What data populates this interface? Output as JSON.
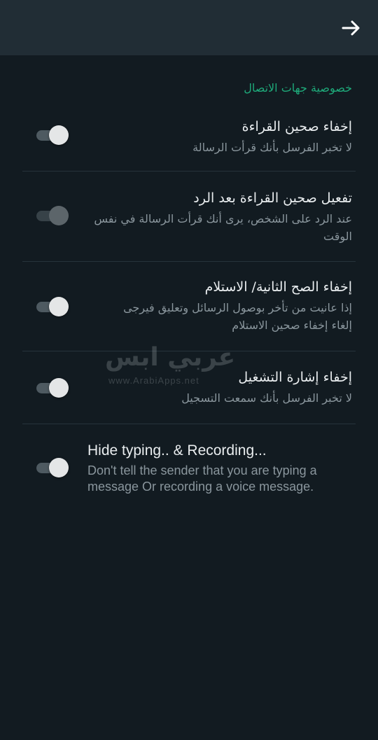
{
  "header": {
    "back_icon": "arrow-right-icon"
  },
  "section": {
    "title": "خصوصية جهات الاتصال"
  },
  "items": [
    {
      "title": "إخفاء صحين القراءة",
      "subtitle": "لا تخبر الفرسل بأنك قرأت الرسالة",
      "enabled": true,
      "disabled": false
    },
    {
      "title": "تفعيل صحين القراءة بعد الرد",
      "subtitle": "عند الرد على الشخص، يرى أنك قرأت الرسالة في نفس الوقت",
      "enabled": true,
      "disabled": true
    },
    {
      "title": "إخفاء الصح الثانية/ الاستلام",
      "subtitle": "إذا عانيت من تأخر بوصول الرسائل وتعليق فيرجى إلغاء إخفاء صحين الاستلام",
      "enabled": true,
      "disabled": false
    },
    {
      "title": "إخفاء إشارة التشغيل",
      "subtitle": "لا تخبر الفرسل بأنك سمعت التسجيل",
      "enabled": true,
      "disabled": false
    },
    {
      "title": "Hide typing.. & Recording...",
      "subtitle": "Don't tell the sender that you are typing a message Or recording a voice message.",
      "enabled": true,
      "disabled": false
    }
  ],
  "watermark": {
    "brand": "عربي ابس",
    "url": "www.ArabiApps.net"
  },
  "colors": {
    "background": "#121b21",
    "appbar": "#212d35",
    "accent": "#1eaa7a"
  }
}
